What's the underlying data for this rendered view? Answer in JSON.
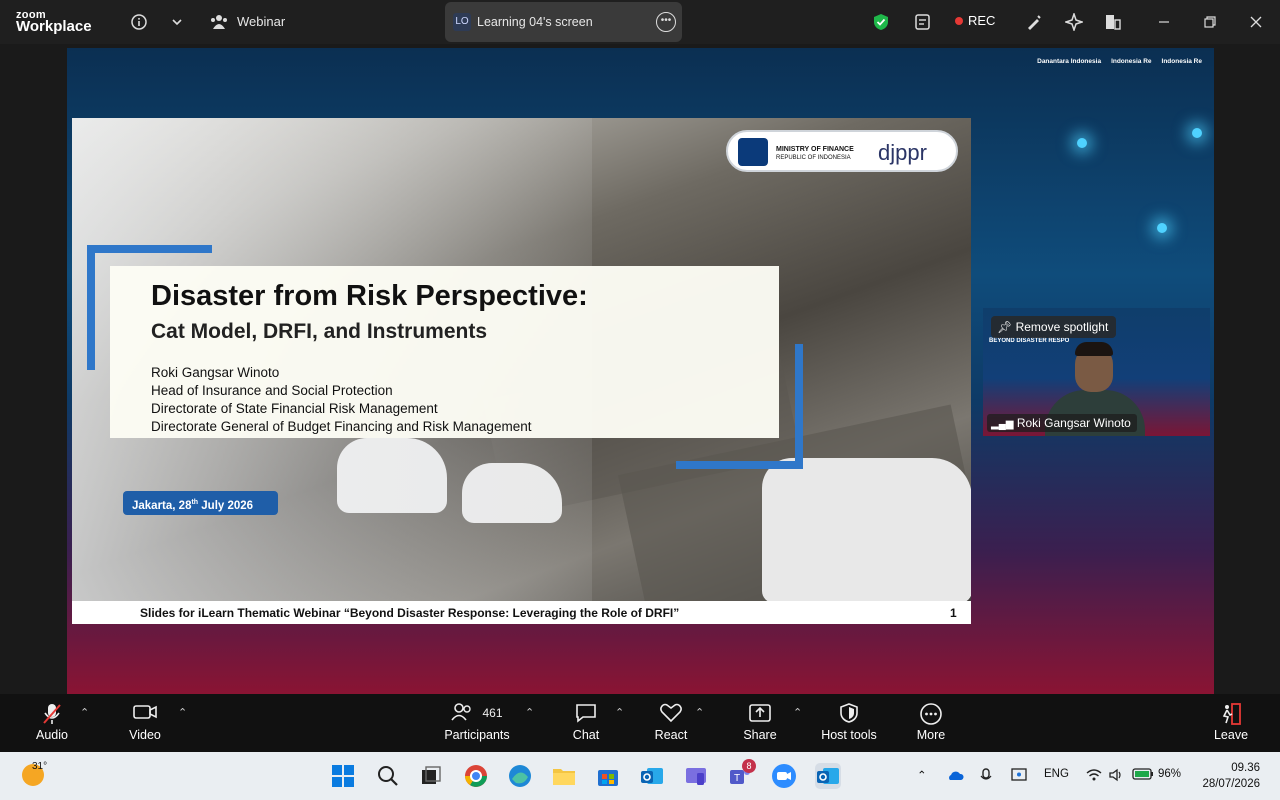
{
  "titlebar": {
    "logo_line1": "zoom",
    "logo_line2": "Workplace",
    "meeting_type": "Webinar",
    "screen_avatar": "LO",
    "screen_title": "Learning 04's screen",
    "rec_label": "REC"
  },
  "slide": {
    "ministry_line1": "MINISTRY OF FINANCE",
    "ministry_line2": "REPUBLIC OF INDONESIA",
    "brand": "djppr",
    "title": "Disaster from Risk Perspective:",
    "subtitle": "Cat Model, DRFI, and Instruments",
    "presenter": "Roki Gangsar Winoto",
    "role1": "Head of Insurance and Social Protection",
    "role2": "Directorate of State Financial Risk Management",
    "role3": "Directorate General of Budget Financing and Risk Management",
    "date_prefix": "Jakarta, 28",
    "date_sup": "th",
    "date_suffix": " July 2026",
    "footer": "Slides for iLearn Thematic Webinar “Beyond Disaster Response: Leveraging the Role of DRFI”",
    "page_number": "1"
  },
  "share_logos": [
    "Danantara Indonesia",
    "Indonesia Re",
    "Indonesia Re"
  ],
  "video": {
    "spotlight_label": "Remove spotlight",
    "participant_name": "Roki Gangsar Winoto",
    "backdrop_text": "BEYOND DISASTER RESPO"
  },
  "toolbar": {
    "audio": "Audio",
    "video": "Video",
    "participants": "Participants",
    "participants_count": "461",
    "chat": "Chat",
    "react": "React",
    "share": "Share",
    "host_tools": "Host tools",
    "more": "More",
    "leave": "Leave"
  },
  "taskbar": {
    "temperature": "31°",
    "teams_badge": "8",
    "language": "ENG",
    "battery": "96%",
    "time": "09.36",
    "date": "28/07/2026"
  },
  "colors": {
    "accent_blue": "#2f77c9",
    "leave_red": "#e53935",
    "shield_green": "#1fb84a"
  }
}
